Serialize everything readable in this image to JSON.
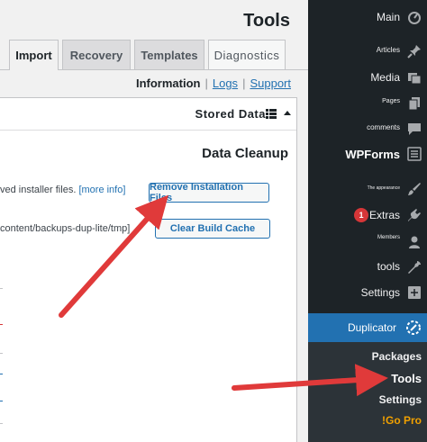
{
  "page": {
    "title": "Tools"
  },
  "tabs": [
    {
      "label": "Import"
    },
    {
      "label": "Recovery"
    },
    {
      "label": "Templates"
    },
    {
      "label": "Diagnostics"
    }
  ],
  "subnav": {
    "current": "Information",
    "logs": "Logs",
    "support": "Support"
  },
  "panel": {
    "header": "Stored Data",
    "section_title": "Data Cleanup",
    "row1_text": "ved installer files.",
    "row1_link": "[more info]",
    "row2_text": "content/backups-dup-lite/tmp]",
    "remove_button": "Remove Installation Files",
    "clear_button": "Clear Build Cache"
  },
  "sidebar": {
    "items": [
      {
        "label": "Main",
        "icon": "dashboard-icon"
      },
      {
        "label": "Articles",
        "icon": "pin-icon"
      },
      {
        "label": "Media",
        "icon": "media-icon"
      },
      {
        "label": "Pages",
        "icon": "pages-icon"
      },
      {
        "label": "comments",
        "icon": "comments-icon"
      },
      {
        "label": "WPForms",
        "icon": "forms-icon"
      },
      {
        "label": "The appearance",
        "icon": "brush-icon"
      },
      {
        "label": "Extras",
        "icon": "plugin-icon",
        "badge": "1"
      },
      {
        "label": "Members",
        "icon": "users-icon"
      },
      {
        "label": "tools",
        "icon": "wrench-icon"
      },
      {
        "label": "Settings",
        "icon": "settings-icon"
      },
      {
        "label": "Duplicator",
        "icon": "duplicator-icon"
      }
    ],
    "submenu": [
      {
        "label": "Packages"
      },
      {
        "label": "Tools"
      },
      {
        "label": "Settings"
      },
      {
        "label": "!Go Pro"
      }
    ]
  },
  "colors": {
    "sidebar_bg": "#1d2327",
    "active": "#2271b1",
    "arrow": "#e03a3a",
    "gopro": "#f0a000"
  }
}
